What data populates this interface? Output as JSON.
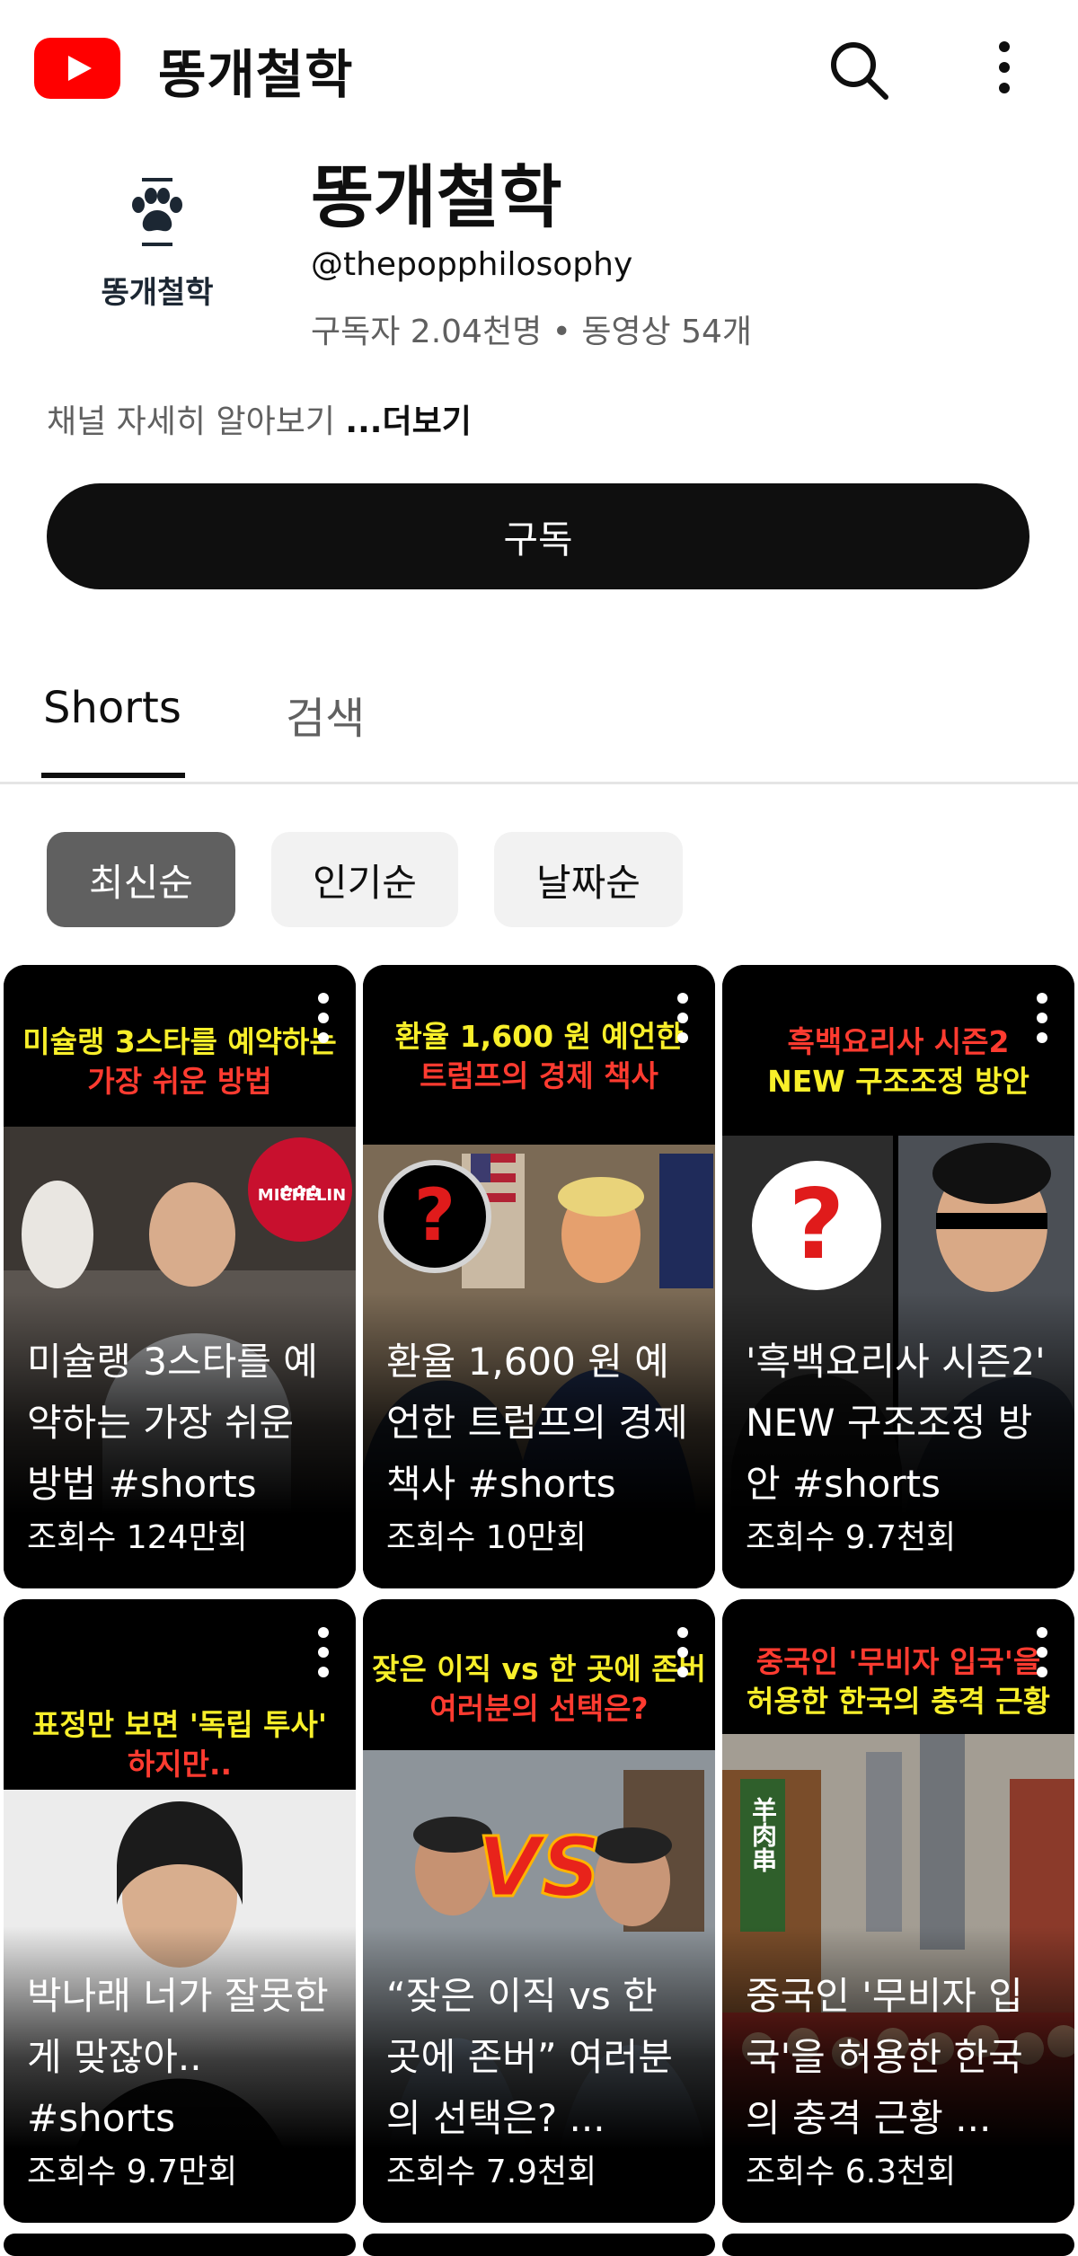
{
  "header": {
    "app_title": "똥개철학"
  },
  "channel": {
    "avatar_text": "똥개철학",
    "name": "똥개철학",
    "handle": "@thepopphilosophy",
    "stats": "구독자 2.04천명 • 동영상 54개",
    "description": "채널 자세히 알아보기 ",
    "more_label": "...더보기",
    "subscribe_label": "구독"
  },
  "tabs": [
    {
      "label": "Shorts",
      "selected": true
    },
    {
      "label": "검색",
      "selected": false
    }
  ],
  "filters": [
    {
      "label": "최신순",
      "selected": true
    },
    {
      "label": "인기순",
      "selected": false
    },
    {
      "label": "날짜순",
      "selected": false
    }
  ],
  "shorts": [
    {
      "caption_1": "미슐랭 3스타를 예약하는",
      "caption_2": "가장 쉬운 방법",
      "badge": "MICHELIN",
      "title": "미슐랭 3스타를 예약하는 가장 쉬운 방법 #shorts",
      "views": "조회수 124만회"
    },
    {
      "caption_1": "환율 1,600 원 예언한",
      "caption_2": "트럼프의 경제 책사",
      "title": "환율 1,600 원 예언한 트럼프의 경제 책사 #shorts",
      "views": "조회수 10만회"
    },
    {
      "caption_1": "흑백요리사 시즌2",
      "caption_2": "NEW 구조조정 방안",
      "title": "'흑백요리사 시즌2' NEW 구조조정 방안 #shorts",
      "views": "조회수 9.7천회"
    },
    {
      "caption_1": "표정만 보면 '독립 투사'",
      "caption_2": "하지만..",
      "title": "박나래 너가 잘못한게 맞잖아.. #shorts",
      "views": "조회수 9.7만회"
    },
    {
      "caption_1": "잦은 이직 vs 한 곳에 존버",
      "caption_2": "여러분의 선택은?",
      "badge": "VS",
      "title": "“잦은 이직 vs 한 곳에 존버” 여러분의 선택은? ...",
      "views": "조회수 7.9천회"
    },
    {
      "caption_1": "중국인 '무비자 입국'을",
      "caption_2": "허용한 한국의 충격 근황",
      "badge": "羊肉串",
      "title": "중국인 '무비자 입국'을 허용한 한국의 충격 근황 ...",
      "views": "조회수 6.3천회"
    }
  ],
  "colors": {
    "youtube_red": "#ff0000",
    "caption_yellow": "#f8ef2a",
    "caption_red": "#ff3b30",
    "selected_chip": "#606060",
    "chip_bg": "#f2f2f2"
  },
  "icons": [
    "youtube-logo-icon",
    "search-icon",
    "more-vert-icon",
    "paw-icon",
    "card-menu-icon",
    "question-mark-icon"
  ]
}
